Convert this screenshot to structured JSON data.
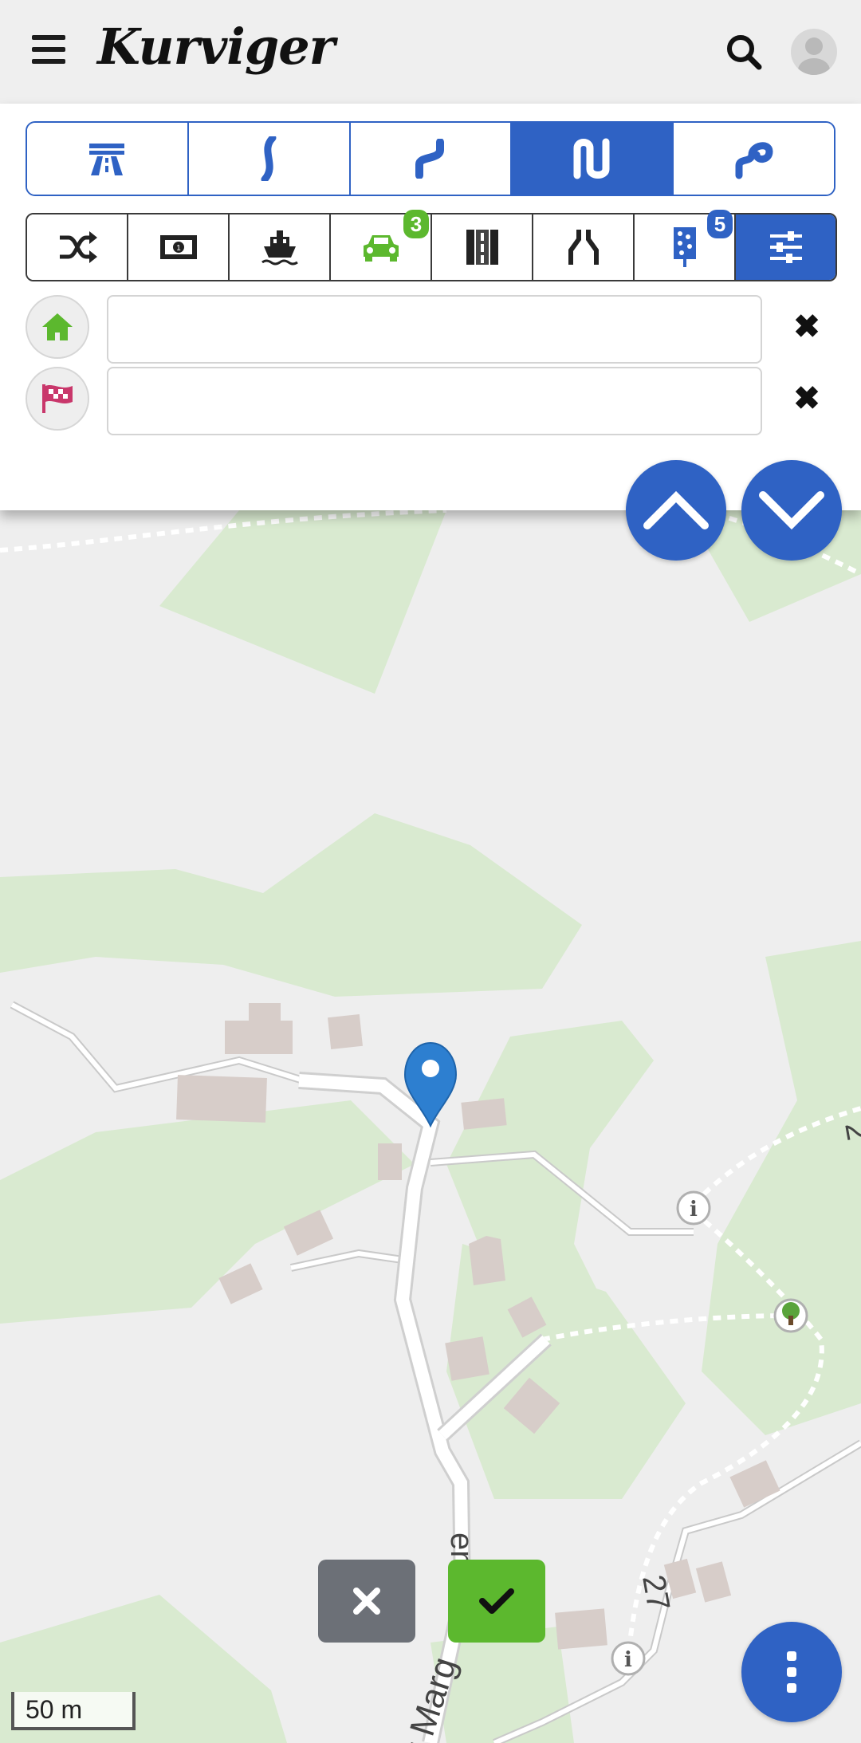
{
  "app": {
    "logo_text": "Kurviger"
  },
  "header": {
    "menu_icon": "hamburger-icon",
    "search_icon": "search-icon",
    "avatar_icon": "user-avatar-icon"
  },
  "curviness": {
    "options": [
      {
        "icon": "highway-icon",
        "active": false
      },
      {
        "icon": "slight-curve-icon",
        "active": false
      },
      {
        "icon": "curvy-icon",
        "active": false
      },
      {
        "icon": "extra-curvy-icon",
        "active": true
      },
      {
        "icon": "curviest-icon",
        "active": false
      }
    ]
  },
  "route_options": {
    "items": [
      {
        "icon": "shuffle-icon"
      },
      {
        "icon": "toll-money-icon"
      },
      {
        "icon": "ferry-icon"
      },
      {
        "icon": "car-icon",
        "badge": "3",
        "badge_color": "#5cb82e"
      },
      {
        "icon": "road-icon"
      },
      {
        "icon": "narrow-road-icon"
      },
      {
        "icon": "unpaved-road-icon",
        "badge": "5",
        "badge_color": "#2f62c4"
      },
      {
        "icon": "settings-sliders-icon"
      }
    ]
  },
  "waypoints": {
    "start": {
      "icon": "home-icon",
      "value": "",
      "placeholder": ""
    },
    "end": {
      "icon": "finish-flag-icon",
      "value": "",
      "placeholder": ""
    }
  },
  "map": {
    "scale_label": "50 m",
    "road_labels": [
      "27",
      "kt Marg",
      "en"
    ],
    "colors": {
      "forest": "#d9ead0",
      "land": "#eeeeee",
      "building": "#d7cdc9",
      "road": "#ffffff",
      "pin": "#2d7fd0"
    }
  },
  "actions": {
    "cancel_icon": "close-icon",
    "confirm_icon": "check-icon"
  },
  "colors": {
    "accent": "#2f62c4",
    "green": "#5cb82e",
    "grey_button": "#6c7077"
  }
}
